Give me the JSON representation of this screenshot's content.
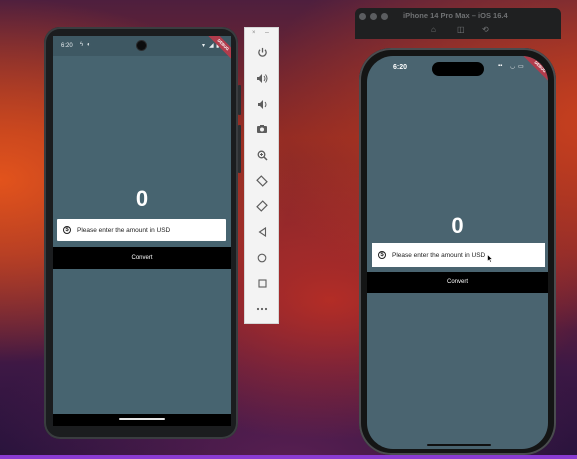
{
  "android": {
    "status_time": "6:20",
    "debug_banner": "DEBUG",
    "counter": "0",
    "input_placeholder": "Please enter the amount in USD",
    "convert_label": "Convert"
  },
  "toolbar": {
    "buttons": [
      "power-icon",
      "volume-up-icon",
      "volume-down-icon",
      "camera-icon",
      "zoom-icon",
      "rotate-left-icon",
      "rotate-right-icon",
      "back-icon",
      "home-icon",
      "overview-icon",
      "more-icon"
    ]
  },
  "ios": {
    "window_title": "iPhone 14 Pro Max – iOS 16.4",
    "status_time": "6:20",
    "debug_banner": "DEBUG",
    "counter": "0",
    "input_placeholder": "Please enter the amount in USD",
    "convert_label": "Convert"
  },
  "colors": {
    "app_background": "#476470",
    "button_background": "#000000",
    "debug_banner": "#b13c4c"
  }
}
